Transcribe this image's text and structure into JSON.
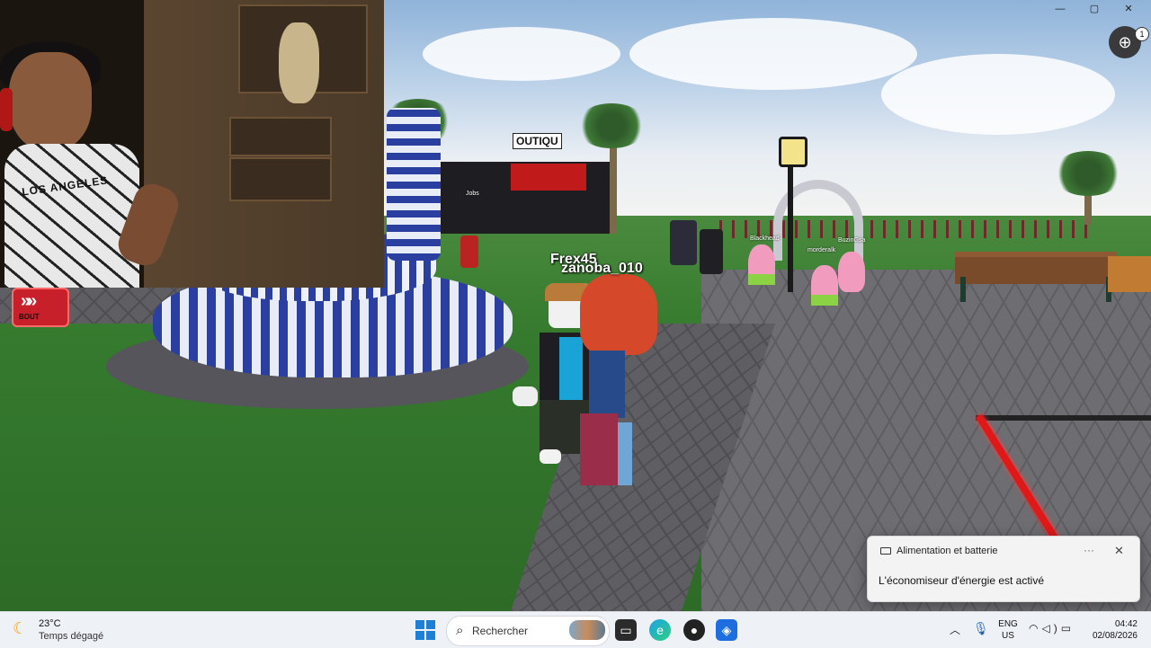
{
  "window": {
    "minimize_glyph": "—",
    "maximize_glyph": "▢",
    "close_glyph": "✕"
  },
  "game": {
    "globe_badge": "1",
    "shop_sign": "OUTIQU",
    "player_names": [
      "Frex45",
      "zanoba_010"
    ],
    "npc_tags": [
      "Jobs",
      "Blackhead",
      "morderalk",
      "BuzinGsa"
    ],
    "skip_button_label": "BOUT",
    "webcam_shirt_text": "LOS ANGELES"
  },
  "notification": {
    "title": "Alimentation et batterie",
    "body": "L'économiseur d'énergie est activé",
    "more_glyph": "···",
    "close_glyph": "✕"
  },
  "taskbar": {
    "weather_temp": "23°C",
    "weather_desc": "Temps dégagé",
    "search_label": "Rechercher",
    "lang_line1": "ENG",
    "lang_line2": "US",
    "time": "04:42",
    "date": "02/08/2026"
  }
}
